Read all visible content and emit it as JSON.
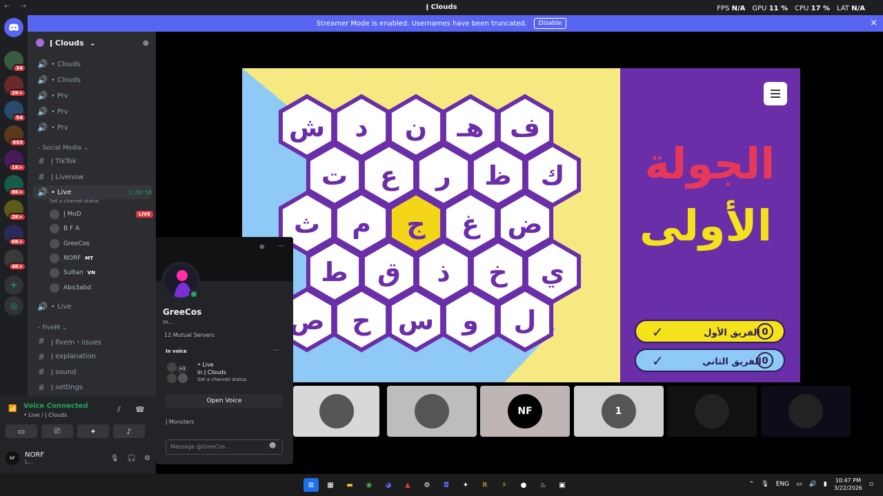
{
  "window": {
    "title": "ǀ Clouds",
    "nav_arrows": "← →",
    "stats": [
      {
        "label": "FPS",
        "value": "N/A"
      },
      {
        "label": "GPU",
        "value": "11 %"
      },
      {
        "label": "CPU",
        "value": "17 %"
      },
      {
        "label": "LAT",
        "value": "N/A"
      }
    ]
  },
  "banner": {
    "text": "Streamer Mode is enabled. Usernames have been truncated.",
    "button": "Disable",
    "close": "×"
  },
  "servers": [
    {
      "badge": "34",
      "icon": "server-1-icon"
    },
    {
      "badge": "2K+",
      "icon": "server-2-icon"
    },
    {
      "badge": "54",
      "icon": "server-3-icon"
    },
    {
      "badge": "693",
      "icon": "server-4-icon"
    },
    {
      "badge": "1K+",
      "icon": "server-5-icon"
    },
    {
      "badge": "8K+",
      "icon": "server-6-icon"
    },
    {
      "badge": "2K+",
      "icon": "server-7-icon"
    },
    {
      "badge": "6K+",
      "icon": "server-8-icon"
    },
    {
      "badge": "4K+",
      "icon": "server-9-icon"
    }
  ],
  "sidebar": {
    "server_name": "ǀ Clouds",
    "voice_channels_top": [
      "• Clouds",
      "• Clouds",
      "• Prv",
      "• Prv",
      "• Prv"
    ],
    "category_social": "Social Media",
    "text_channels_social": [
      "ǀ TikTok",
      "ǀ Livenow"
    ],
    "live_channel": {
      "name": "• Live",
      "time": "1:34:50",
      "status": "Set a channel status"
    },
    "members": [
      {
        "name": "ǀ MoD",
        "tag": "LIVE"
      },
      {
        "name": "B F A",
        "tag": ""
      },
      {
        "name": "GreeCos",
        "tag": ""
      },
      {
        "name": "NORF",
        "tag": "MT"
      },
      {
        "name": "Sultan",
        "tag": "VN"
      },
      {
        "name": "Abo3abd",
        "tag": ""
      }
    ],
    "live_channel_2": "• Live",
    "category_fivem": "FiveM",
    "text_channels_fivem": [
      "ǀ fivem・iisues",
      "ǀ explanation",
      "ǀ sound",
      "ǀ settings"
    ]
  },
  "voice_panel": {
    "status": "Voice Connected",
    "location": "• Live / ǀ Clouds",
    "user_name": "NORF",
    "user_sub": "L...",
    "avatar_text": "NF"
  },
  "popup": {
    "name": "GreeCos",
    "sub": "m...",
    "mutual": "12 Mutual Servers",
    "in_voice_label": "In voice",
    "voice_channel": "• Live",
    "voice_in": "in  ǀ Clouds",
    "voice_status": "Set a channel status",
    "voice_more": "+3",
    "open_voice": "Open Voice",
    "server": "ǀ Monsters",
    "message_placeholder": "Message @GreeCos"
  },
  "game": {
    "round_title_line1": "الجولة",
    "round_title_line2": "الأولى",
    "team1": "الفريق الأول",
    "team2": "الفريق الثاني",
    "team1_score": "0",
    "team2_score": "0",
    "hex_rows": [
      [
        "ف",
        "هـ",
        "ن",
        "د",
        "ش"
      ],
      [
        "ك",
        "ظ",
        "ر",
        "ع",
        "ت"
      ],
      [
        "ض",
        "غ",
        "ج",
        "م",
        "ث"
      ],
      [
        "ي",
        "خ",
        "ذ",
        "ق",
        "ط"
      ],
      [
        "ل",
        "و",
        "س",
        "ح",
        "ص"
      ]
    ],
    "highlight": "ج",
    "colors": {
      "board": "#6a2ea8",
      "yellow": "#f6e982",
      "blue": "#8ecaf5",
      "hex_border": "#6a2ea8",
      "selected": "#f4d619",
      "red_text": "#e8385a",
      "yellow_text": "#f4e21a"
    }
  },
  "thumbnails": [
    {
      "name": "tile-1",
      "label": ""
    },
    {
      "name": "tile-2",
      "label": ""
    },
    {
      "name": "tile-3",
      "label": "NF"
    },
    {
      "name": "tile-4",
      "label": "1"
    },
    {
      "name": "tile-5",
      "label": ""
    },
    {
      "name": "tile-6",
      "label": ""
    }
  ],
  "taskbar": {
    "lang": "ENG",
    "time": "10:47 PM",
    "date": "3/22/2026"
  }
}
